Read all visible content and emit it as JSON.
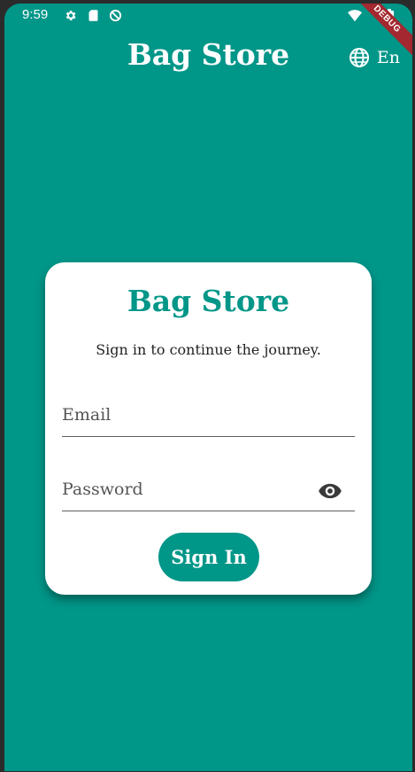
{
  "status_bar": {
    "time": "9:59",
    "icons": [
      "settings-icon",
      "sd-card-icon",
      "no-disturb-icon",
      "wifi-icon",
      "battery-icon"
    ]
  },
  "debug_banner": "DEBUG",
  "app_bar": {
    "title": "Bag Store",
    "language_label": "En",
    "language_icon": "globe-icon"
  },
  "card": {
    "title": "Bag Store",
    "subtitle": "Sign in to continue the journey.",
    "email_placeholder": "Email",
    "password_placeholder": "Password",
    "password_toggle_icon": "eye-icon",
    "submit_label": "Sign In"
  },
  "colors": {
    "primary": "#009688",
    "card_background": "#ffffff",
    "debug_ribbon": "#a3282f"
  }
}
